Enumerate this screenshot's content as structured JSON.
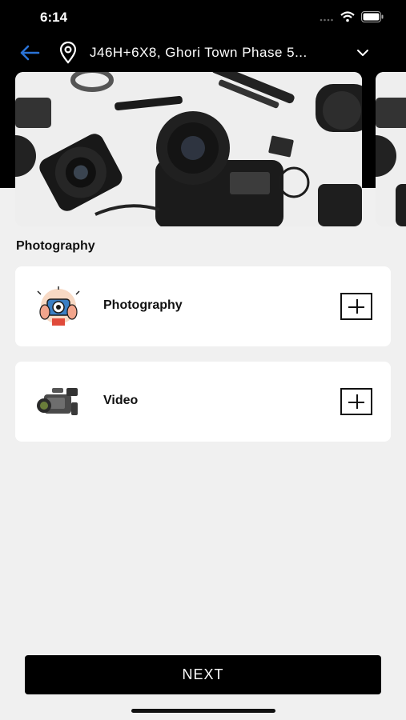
{
  "status": {
    "time": "6:14"
  },
  "location": {
    "address": "J46H+6X8,  Ghori Town Phase 5..."
  },
  "section": {
    "title": "Photography"
  },
  "services": [
    {
      "label": "Photography",
      "icon": "photographer-icon"
    },
    {
      "label": "Video",
      "icon": "video-camera-icon"
    }
  ],
  "footer": {
    "next_label": "NEXT"
  },
  "colors": {
    "accent": "#2a73d6",
    "header_bg": "#000000",
    "page_bg": "#f0f0f0"
  }
}
